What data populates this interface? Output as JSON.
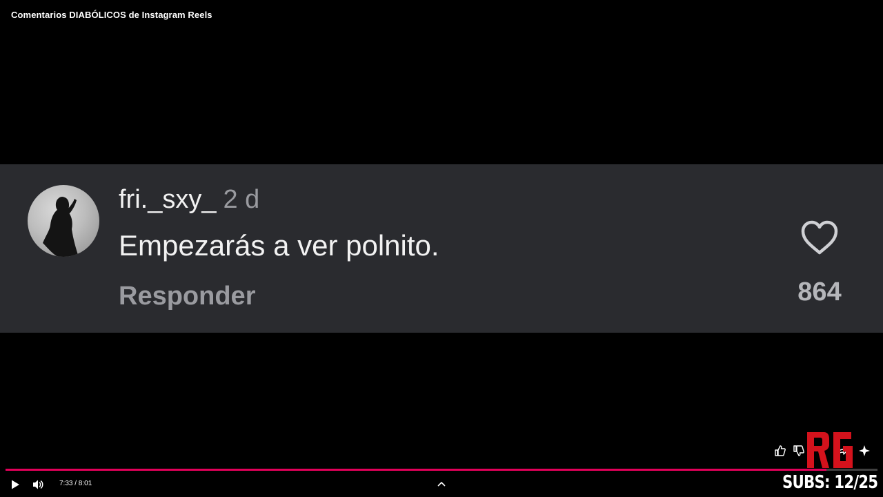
{
  "video": {
    "title": "Comentarios DIABÓLICOS de Instagram Reels"
  },
  "comment": {
    "username": "fri._sxy_",
    "time_ago": "2 d",
    "text": "Empezarás a ver polnito.",
    "reply_label": "Responder",
    "like_count": "864",
    "avatar_icon": "profile-photo"
  },
  "player": {
    "time_display": "7:33 / 8:01",
    "progress_fraction": 0.9418,
    "progress_color": "#e3005a",
    "icons": [
      "play-icon",
      "volume-icon",
      "chevron-up-icon",
      "thumbs-up-icon",
      "thumbs-down-icon",
      "share-icon",
      "sparkle-icon"
    ]
  },
  "overlay": {
    "logo_text": "RG",
    "logo_color": "#d4121c",
    "subs_text": "SUBS: 12/25"
  }
}
